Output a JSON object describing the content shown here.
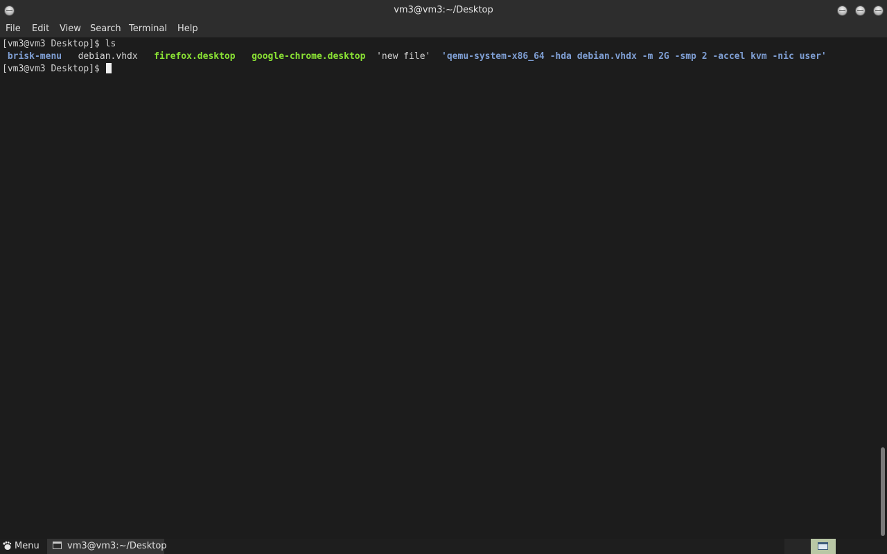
{
  "window": {
    "title": "vm3@vm3:~/Desktop"
  },
  "menubar": {
    "items": [
      "File",
      "Edit",
      "View",
      "Search",
      "Terminal",
      "Help"
    ]
  },
  "terminal": {
    "line1": {
      "prompt": "[vm3@vm3 Desktop]$ ",
      "command": "ls"
    },
    "ls_output": [
      {
        "name": "brisk-menu",
        "kind": "directory"
      },
      {
        "name": "debian.vhdx",
        "kind": "file"
      },
      {
        "name": "firefox.desktop",
        "kind": "executable"
      },
      {
        "name": "google-chrome.desktop",
        "kind": "executable"
      },
      {
        "name": "'new file'",
        "kind": "file"
      },
      {
        "name": "'qemu-system-x86_64 -hda debian.vhdx -m 2G -smp 2 -accel kvm -nic user'",
        "kind": "directory"
      }
    ],
    "line3": {
      "prompt": "[vm3@vm3 Desktop]$ "
    }
  },
  "taskbar": {
    "menu_label": "Menu",
    "task_label": "vm3@vm3:~/Desktop"
  },
  "colors": {
    "directory": "#7f9fd4",
    "executable": "#8ae234",
    "text": "#d3d3d3",
    "background": "#1c1c1c"
  }
}
